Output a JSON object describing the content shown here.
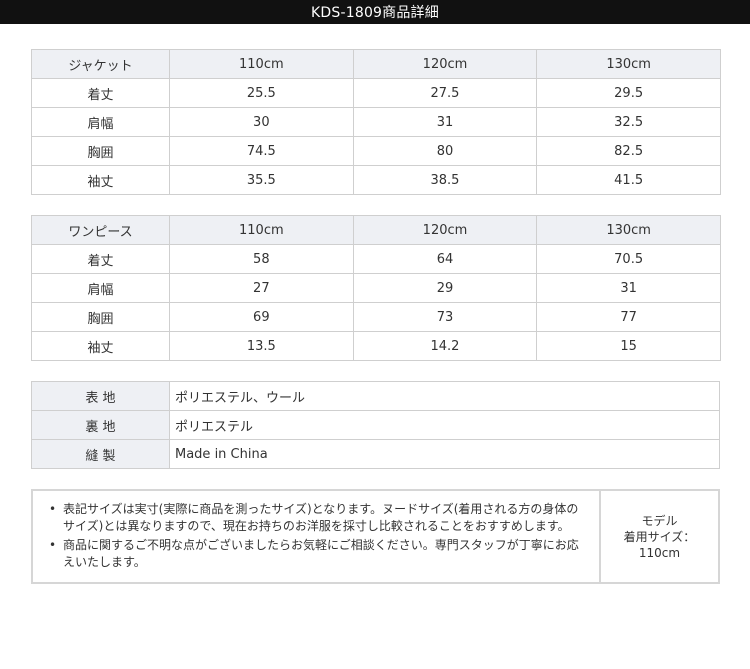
{
  "header": {
    "title": "KDS-1809商品詳細"
  },
  "jacket": {
    "columns": [
      "ジャケット",
      "110cm",
      "120cm",
      "130cm"
    ],
    "rows": [
      [
        "着丈",
        "25.5",
        "27.5",
        "29.5"
      ],
      [
        "肩幅",
        "30",
        "31",
        "32.5"
      ],
      [
        "胸囲",
        "74.5",
        "80",
        "82.5"
      ],
      [
        "袖丈",
        "35.5",
        "38.5",
        "41.5"
      ]
    ]
  },
  "onepiece": {
    "columns": [
      "ワンピース",
      "110cm",
      "120cm",
      "130cm"
    ],
    "rows": [
      [
        "着丈",
        "58",
        "64",
        "70.5"
      ],
      [
        "肩幅",
        "27",
        "29",
        "31"
      ],
      [
        "胸囲",
        "69",
        "73",
        "77"
      ],
      [
        "袖丈",
        "13.5",
        "14.2",
        "15"
      ]
    ]
  },
  "material": {
    "rows": [
      {
        "label": "表 地",
        "value": "ポリエステル、ウール"
      },
      {
        "label": "裏 地",
        "value": "ポリエステル"
      },
      {
        "label": "縫 製",
        "value": "Made in China"
      }
    ]
  },
  "notes": {
    "bullet": "•",
    "items": [
      "表記サイズは実寸(実際に商品を測ったサイズ)となります。ヌードサイズ(着用される方の身体のサイズ)とは異なりますので、現在お持ちのお洋服を採寸し比較されることをおすすめします。",
      "商品に関するご不明な点がございましたらお気軽にご相談ください。専門スタッフが丁寧にお応えいたします。"
    ],
    "model": {
      "line1": "モデル",
      "line2": "着用サイズ：",
      "line3": "110cm"
    }
  }
}
